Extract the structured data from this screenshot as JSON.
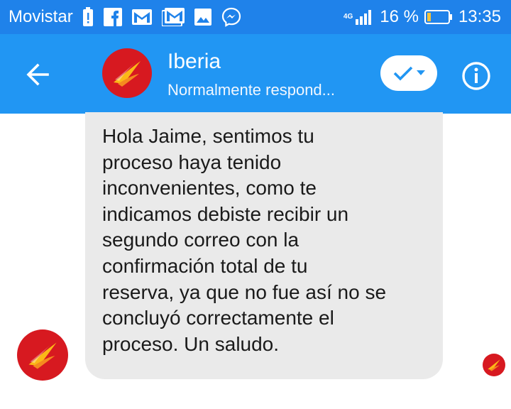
{
  "status_bar": {
    "carrier": "Movistar",
    "network": "4G",
    "battery": "16 %",
    "time": "13:35",
    "icons": [
      "battery-alert-icon",
      "facebook-icon",
      "gmail-icon",
      "gmail-icon",
      "gallery-icon",
      "messenger-icon",
      "signal-icon",
      "battery-icon"
    ]
  },
  "header": {
    "back_icon": "arrow-left-icon",
    "contact_name": "Iberia",
    "contact_status": "Normalmente respond...",
    "check_icon": "checkmark-icon",
    "info_icon": "info-icon"
  },
  "chat": {
    "message": "Hola Jaime, sentimos tu\nproceso haya tenido\ninconvenientes, como te\nindicamos debiste recibir un\nsegundo correo con la\nconfirmación total de tu\nreserva, ya que no fue así no se\nconcluyó correctamente el\nproceso. Un saludo."
  },
  "colors": {
    "status_bar": "#1f82ea",
    "app_bar": "#2196f3",
    "bubble": "#eaeaea",
    "brand_red": "#d71920",
    "brand_yellow": "#fbb817"
  }
}
